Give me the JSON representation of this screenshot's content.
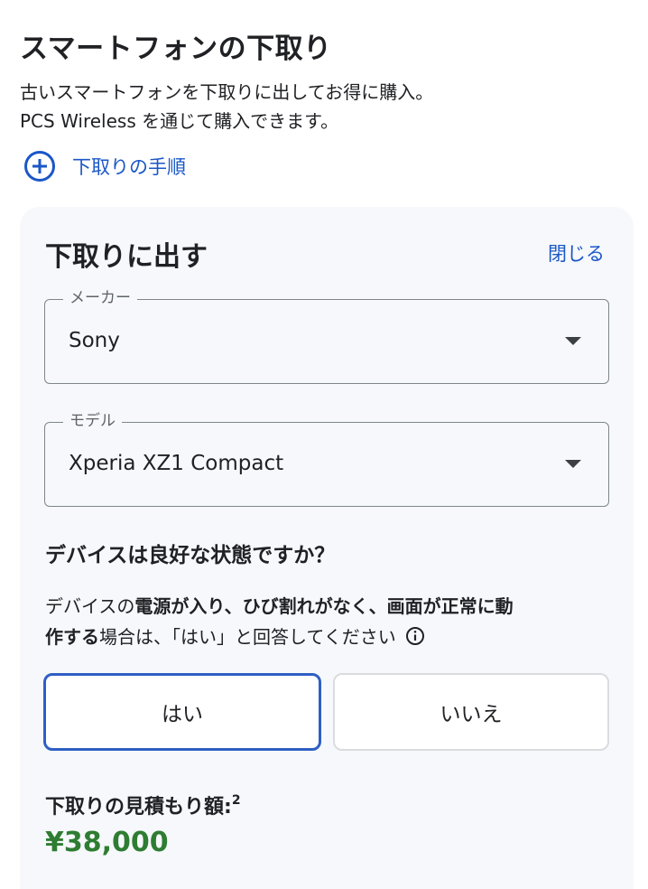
{
  "header": {
    "title": "スマートフォンの下取り",
    "description_line1": "古いスマートフォンを下取りに出してお得に購入。",
    "description_line2": "PCS Wireless を通じて購入できます。",
    "howto_label": "下取りの手順"
  },
  "tradein": {
    "title": "下取りに出す",
    "close_label": "閉じる",
    "maker": {
      "label": "メーカー",
      "value": "Sony"
    },
    "model": {
      "label": "モデル",
      "value": "Xperia XZ1 Compact"
    },
    "question": "デバイスは良好な状態ですか？",
    "instructions": {
      "part1": "デバイスの",
      "bold1": "電源が入り、ひび割れがなく、画面が正常に動",
      "bold2": "作する",
      "part2": "場合は、「はい」と回答してください"
    },
    "yes_label": "はい",
    "no_label": "いいえ",
    "selected_answer": "はい",
    "estimate_label": "下取りの見積もり額:",
    "estimate_footnote": "2",
    "estimate_value": "¥38,000"
  },
  "colors": {
    "link_blue": "#1a57c7",
    "selected_border": "#2f5fc4",
    "price_green": "#2e7d32",
    "card_bg": "#f6f8fb"
  },
  "icons": {
    "howto": "plus-circle-icon",
    "info": "info-icon",
    "dropdown": "dropdown-arrow-icon"
  }
}
